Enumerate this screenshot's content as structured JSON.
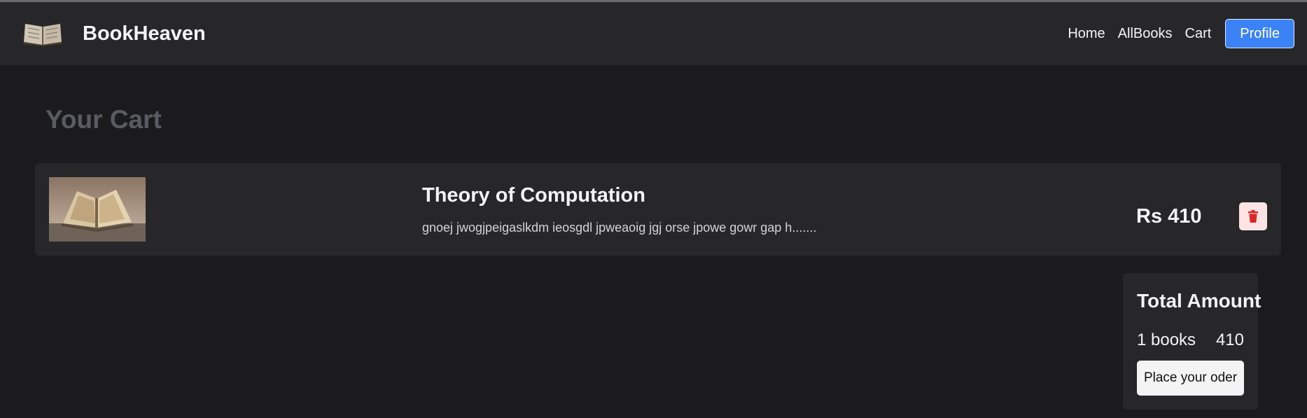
{
  "header": {
    "brand": "BookHeaven",
    "nav": [
      "Home",
      "AllBooks",
      "Cart"
    ],
    "profile_label": "Profile"
  },
  "page": {
    "title": "Your Cart"
  },
  "cart": {
    "items": [
      {
        "title": "Theory of Computation",
        "description": "gnoej jwogjpeigaslkdm ieosgdl jpweaoig jgj orse jpowe gowr gap h.......",
        "price": "Rs 410",
        "image": "open-book-photo"
      }
    ]
  },
  "summary": {
    "title": "Total Amount",
    "count": "1 books",
    "total": "410",
    "order_label": "Place your oder"
  },
  "colors": {
    "background": "#1b1b1e",
    "panel": "#27272a",
    "accent": "#3b82f6",
    "danger": "#dc2626",
    "muted_title": "#5a5a62"
  },
  "icons": [
    "book-logo-icon",
    "trash-icon"
  ]
}
